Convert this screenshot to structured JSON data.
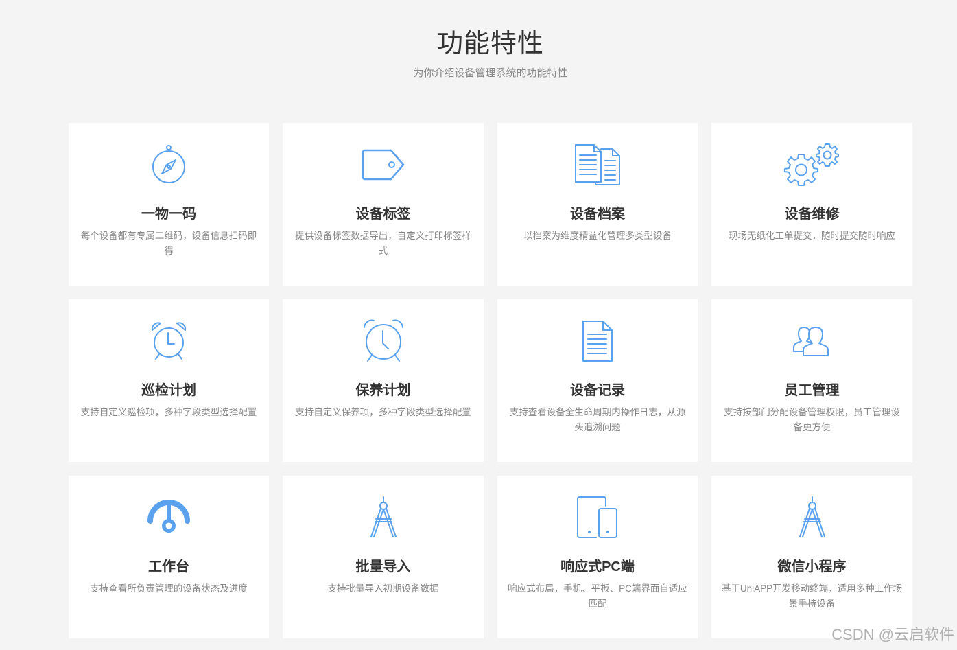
{
  "header": {
    "title": "功能特性",
    "subtitle": "为你介绍设备管理系统的功能特性"
  },
  "accent_color": "#5aa2ee",
  "features": [
    {
      "icon": "compass-icon",
      "title": "一物一码",
      "desc": "每个设备都有专属二维码，设备信息扫码即得"
    },
    {
      "icon": "tag-icon",
      "title": "设备标签",
      "desc": "提供设备标签数据导出，自定义打印标签样式"
    },
    {
      "icon": "documents-icon",
      "title": "设备档案",
      "desc": "以档案为维度精益化管理多类型设备"
    },
    {
      "icon": "gears-icon",
      "title": "设备维修",
      "desc": "现场无纸化工单提交，随时提交随时响应"
    },
    {
      "icon": "alarm-clock-icon",
      "title": "巡检计划",
      "desc": "支持自定义巡检项，多种字段类型选择配置"
    },
    {
      "icon": "alarm-clock-icon",
      "title": "保养计划",
      "desc": "支持自定义保养项，多种字段类型选择配置"
    },
    {
      "icon": "document-icon",
      "title": "设备记录",
      "desc": "支持查看设备全生命周期内操作日志，从源头追溯问题"
    },
    {
      "icon": "users-icon",
      "title": "员工管理",
      "desc": "支持按部门分配设备管理权限，员工管理设备更方便"
    },
    {
      "icon": "dashboard-icon",
      "title": "工作台",
      "desc": "支持查看所负责管理的设备状态及进度"
    },
    {
      "icon": "drafting-compass-icon",
      "title": "批量导入",
      "desc": "支持批量导入初期设备数据"
    },
    {
      "icon": "devices-icon",
      "title": "响应式PC端",
      "desc": "响应式布局，手机、平板、PC端界面自适应匹配"
    },
    {
      "icon": "drafting-compass-icon",
      "title": "微信小程序",
      "desc": "基于UniAPP开发移动终端，适用多种工作场景手持设备"
    }
  ],
  "watermark": "CSDN @云启软件"
}
